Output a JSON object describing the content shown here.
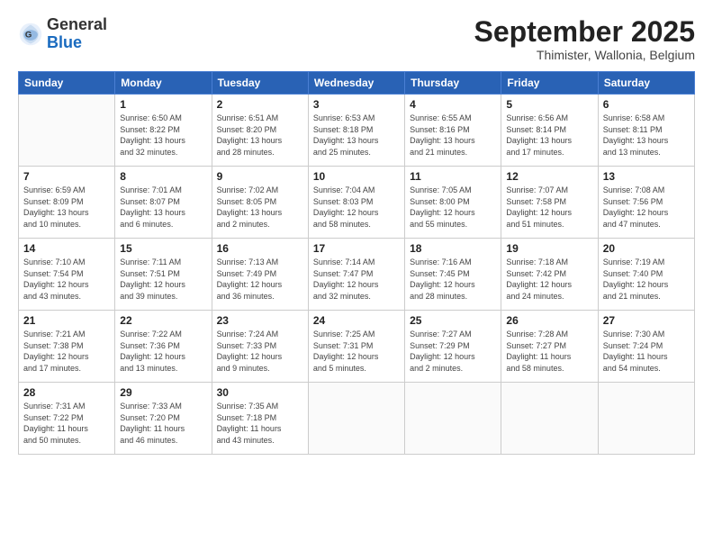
{
  "header": {
    "logo_general": "General",
    "logo_blue": "Blue",
    "month_title": "September 2025",
    "subtitle": "Thimister, Wallonia, Belgium"
  },
  "days_of_week": [
    "Sunday",
    "Monday",
    "Tuesday",
    "Wednesday",
    "Thursday",
    "Friday",
    "Saturday"
  ],
  "weeks": [
    [
      {
        "day": "",
        "info": ""
      },
      {
        "day": "1",
        "info": "Sunrise: 6:50 AM\nSunset: 8:22 PM\nDaylight: 13 hours\nand 32 minutes."
      },
      {
        "day": "2",
        "info": "Sunrise: 6:51 AM\nSunset: 8:20 PM\nDaylight: 13 hours\nand 28 minutes."
      },
      {
        "day": "3",
        "info": "Sunrise: 6:53 AM\nSunset: 8:18 PM\nDaylight: 13 hours\nand 25 minutes."
      },
      {
        "day": "4",
        "info": "Sunrise: 6:55 AM\nSunset: 8:16 PM\nDaylight: 13 hours\nand 21 minutes."
      },
      {
        "day": "5",
        "info": "Sunrise: 6:56 AM\nSunset: 8:14 PM\nDaylight: 13 hours\nand 17 minutes."
      },
      {
        "day": "6",
        "info": "Sunrise: 6:58 AM\nSunset: 8:11 PM\nDaylight: 13 hours\nand 13 minutes."
      }
    ],
    [
      {
        "day": "7",
        "info": "Sunrise: 6:59 AM\nSunset: 8:09 PM\nDaylight: 13 hours\nand 10 minutes."
      },
      {
        "day": "8",
        "info": "Sunrise: 7:01 AM\nSunset: 8:07 PM\nDaylight: 13 hours\nand 6 minutes."
      },
      {
        "day": "9",
        "info": "Sunrise: 7:02 AM\nSunset: 8:05 PM\nDaylight: 13 hours\nand 2 minutes."
      },
      {
        "day": "10",
        "info": "Sunrise: 7:04 AM\nSunset: 8:03 PM\nDaylight: 12 hours\nand 58 minutes."
      },
      {
        "day": "11",
        "info": "Sunrise: 7:05 AM\nSunset: 8:00 PM\nDaylight: 12 hours\nand 55 minutes."
      },
      {
        "day": "12",
        "info": "Sunrise: 7:07 AM\nSunset: 7:58 PM\nDaylight: 12 hours\nand 51 minutes."
      },
      {
        "day": "13",
        "info": "Sunrise: 7:08 AM\nSunset: 7:56 PM\nDaylight: 12 hours\nand 47 minutes."
      }
    ],
    [
      {
        "day": "14",
        "info": "Sunrise: 7:10 AM\nSunset: 7:54 PM\nDaylight: 12 hours\nand 43 minutes."
      },
      {
        "day": "15",
        "info": "Sunrise: 7:11 AM\nSunset: 7:51 PM\nDaylight: 12 hours\nand 39 minutes."
      },
      {
        "day": "16",
        "info": "Sunrise: 7:13 AM\nSunset: 7:49 PM\nDaylight: 12 hours\nand 36 minutes."
      },
      {
        "day": "17",
        "info": "Sunrise: 7:14 AM\nSunset: 7:47 PM\nDaylight: 12 hours\nand 32 minutes."
      },
      {
        "day": "18",
        "info": "Sunrise: 7:16 AM\nSunset: 7:45 PM\nDaylight: 12 hours\nand 28 minutes."
      },
      {
        "day": "19",
        "info": "Sunrise: 7:18 AM\nSunset: 7:42 PM\nDaylight: 12 hours\nand 24 minutes."
      },
      {
        "day": "20",
        "info": "Sunrise: 7:19 AM\nSunset: 7:40 PM\nDaylight: 12 hours\nand 21 minutes."
      }
    ],
    [
      {
        "day": "21",
        "info": "Sunrise: 7:21 AM\nSunset: 7:38 PM\nDaylight: 12 hours\nand 17 minutes."
      },
      {
        "day": "22",
        "info": "Sunrise: 7:22 AM\nSunset: 7:36 PM\nDaylight: 12 hours\nand 13 minutes."
      },
      {
        "day": "23",
        "info": "Sunrise: 7:24 AM\nSunset: 7:33 PM\nDaylight: 12 hours\nand 9 minutes."
      },
      {
        "day": "24",
        "info": "Sunrise: 7:25 AM\nSunset: 7:31 PM\nDaylight: 12 hours\nand 5 minutes."
      },
      {
        "day": "25",
        "info": "Sunrise: 7:27 AM\nSunset: 7:29 PM\nDaylight: 12 hours\nand 2 minutes."
      },
      {
        "day": "26",
        "info": "Sunrise: 7:28 AM\nSunset: 7:27 PM\nDaylight: 11 hours\nand 58 minutes."
      },
      {
        "day": "27",
        "info": "Sunrise: 7:30 AM\nSunset: 7:24 PM\nDaylight: 11 hours\nand 54 minutes."
      }
    ],
    [
      {
        "day": "28",
        "info": "Sunrise: 7:31 AM\nSunset: 7:22 PM\nDaylight: 11 hours\nand 50 minutes."
      },
      {
        "day": "29",
        "info": "Sunrise: 7:33 AM\nSunset: 7:20 PM\nDaylight: 11 hours\nand 46 minutes."
      },
      {
        "day": "30",
        "info": "Sunrise: 7:35 AM\nSunset: 7:18 PM\nDaylight: 11 hours\nand 43 minutes."
      },
      {
        "day": "",
        "info": ""
      },
      {
        "day": "",
        "info": ""
      },
      {
        "day": "",
        "info": ""
      },
      {
        "day": "",
        "info": ""
      }
    ]
  ]
}
